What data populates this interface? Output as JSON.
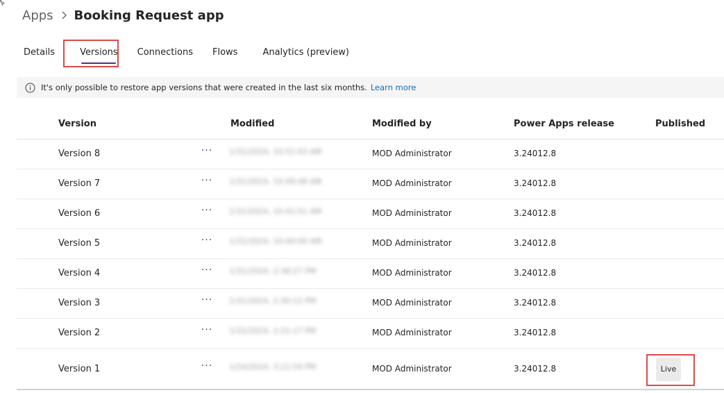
{
  "breadcrumb": {
    "root": "Apps",
    "current": "Booking Request app"
  },
  "tabs": [
    {
      "label": "Details"
    },
    {
      "label": "Versions"
    },
    {
      "label": "Connections"
    },
    {
      "label": "Flows"
    },
    {
      "label": "Analytics (preview)"
    }
  ],
  "active_tab": "Versions",
  "notice": {
    "text": "It's only possible to restore app versions that were created in the last six months.",
    "link": "Learn more"
  },
  "table": {
    "headers": [
      "Version",
      "Modified",
      "Modified by",
      "Power Apps release",
      "Published"
    ],
    "rows": [
      {
        "version": "Version 8",
        "modified": "1/31/2024, 10:51:03 AM",
        "modified_by": "MOD Administrator",
        "release": "3.24012.8",
        "published": ""
      },
      {
        "version": "Version 7",
        "modified": "1/31/2024, 10:49:48 AM",
        "modified_by": "MOD Administrator",
        "release": "3.24012.8",
        "published": ""
      },
      {
        "version": "Version 6",
        "modified": "1/31/2024, 10:41:51 AM",
        "modified_by": "MOD Administrator",
        "release": "3.24012.8",
        "published": ""
      },
      {
        "version": "Version 5",
        "modified": "1/31/2024, 10:40:00 AM",
        "modified_by": "MOD Administrator",
        "release": "3.24012.8",
        "published": ""
      },
      {
        "version": "Version 4",
        "modified": "1/31/2024, 2:38:27 PM",
        "modified_by": "MOD Administrator",
        "release": "3.24012.8",
        "published": ""
      },
      {
        "version": "Version 3",
        "modified": "1/31/2024, 2:30:12 PM",
        "modified_by": "MOD Administrator",
        "release": "3.24012.8",
        "published": ""
      },
      {
        "version": "Version 2",
        "modified": "1/31/2024, 2:21:17 PM",
        "modified_by": "MOD Administrator",
        "release": "3.24012.8",
        "published": ""
      },
      {
        "version": "Version 1",
        "modified": "1/24/2024, 3:11:54 PM",
        "modified_by": "MOD Administrator",
        "release": "3.24012.8",
        "published": "Live"
      }
    ]
  },
  "more_label": "···",
  "colors": {
    "accent": "#5b2a86",
    "link": "#0f6cbd",
    "highlight": "#e04949"
  }
}
